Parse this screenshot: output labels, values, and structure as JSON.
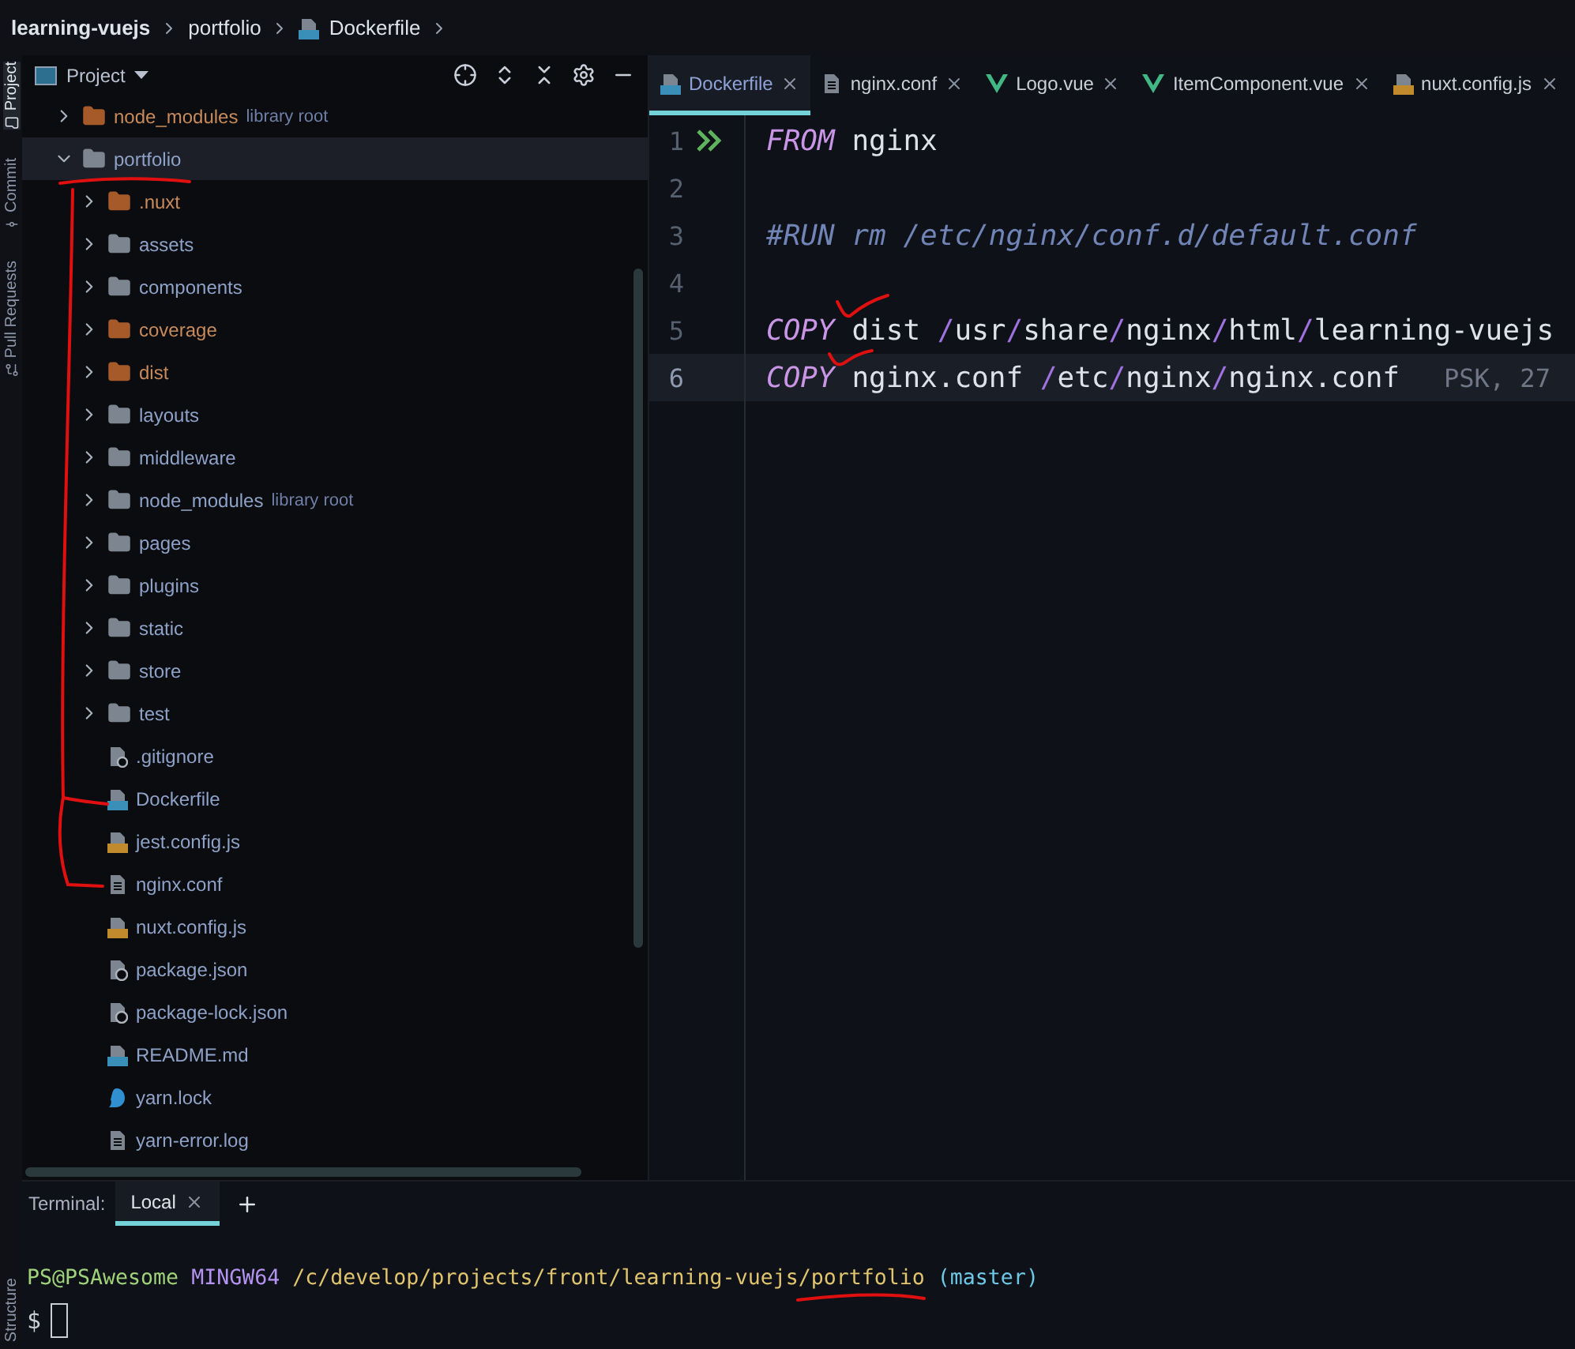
{
  "breadcrumbs": [
    {
      "label": "learning-vuejs",
      "kind": "project"
    },
    {
      "label": "portfolio",
      "kind": "folder"
    },
    {
      "label": "Dockerfile",
      "kind": "docker"
    }
  ],
  "tool_strip": [
    {
      "label": "Project",
      "selected": true,
      "kind": "folder"
    },
    {
      "label": "Commit",
      "selected": false,
      "kind": "commit"
    },
    {
      "label": "Pull Requests",
      "selected": false,
      "kind": "pull"
    }
  ],
  "bottom_tool_strip": [
    {
      "label": "Structure",
      "selected": false
    }
  ],
  "project_panel": {
    "title": "Project",
    "tree": [
      {
        "name": "node_modules",
        "kind": "folder",
        "ignored": true,
        "note": "library root",
        "expanded": false,
        "selected": false
      },
      {
        "name": "portfolio",
        "kind": "folder",
        "ignored": false,
        "expanded": true,
        "selected": true,
        "children": [
          {
            "name": ".nuxt",
            "kind": "folder",
            "ignored": true,
            "expanded": false,
            "selected": false
          },
          {
            "name": "assets",
            "kind": "folder",
            "ignored": false,
            "expanded": false,
            "selected": false
          },
          {
            "name": "components",
            "kind": "folder",
            "ignored": false,
            "expanded": false,
            "selected": false
          },
          {
            "name": "coverage",
            "kind": "folder",
            "ignored": true,
            "expanded": false,
            "selected": false
          },
          {
            "name": "dist",
            "kind": "folder",
            "ignored": true,
            "expanded": false,
            "selected": false
          },
          {
            "name": "layouts",
            "kind": "folder",
            "ignored": false,
            "expanded": false,
            "selected": false
          },
          {
            "name": "middleware",
            "kind": "folder",
            "ignored": false,
            "expanded": false,
            "selected": false
          },
          {
            "name": "node_modules",
            "kind": "folder",
            "ignored": false,
            "note": "library root",
            "expanded": false,
            "selected": false
          },
          {
            "name": "pages",
            "kind": "folder",
            "ignored": false,
            "expanded": false,
            "selected": false
          },
          {
            "name": "plugins",
            "kind": "folder",
            "ignored": false,
            "expanded": false,
            "selected": false
          },
          {
            "name": "static",
            "kind": "folder",
            "ignored": false,
            "expanded": false,
            "selected": false
          },
          {
            "name": "store",
            "kind": "folder",
            "ignored": false,
            "expanded": false,
            "selected": false
          },
          {
            "name": "test",
            "kind": "folder",
            "ignored": false,
            "expanded": false,
            "selected": false
          },
          {
            "name": ".gitignore",
            "kind": "gitignore",
            "selected": false
          },
          {
            "name": "Dockerfile",
            "kind": "docker",
            "selected": false
          },
          {
            "name": "jest.config.js",
            "kind": "js",
            "selected": false
          },
          {
            "name": "nginx.conf",
            "kind": "text",
            "selected": false
          },
          {
            "name": "nuxt.config.js",
            "kind": "js",
            "selected": false
          },
          {
            "name": "package.json",
            "kind": "json",
            "selected": false
          },
          {
            "name": "package-lock.json",
            "kind": "json",
            "selected": false
          },
          {
            "name": "README.md",
            "kind": "md",
            "selected": false
          },
          {
            "name": "yarn.lock",
            "kind": "yarn",
            "selected": false
          },
          {
            "name": "yarn-error.log",
            "kind": "text",
            "selected": false
          }
        ]
      }
    ]
  },
  "editor": {
    "tabs": [
      {
        "label": "Dockerfile",
        "kind": "docker",
        "selected": true
      },
      {
        "label": "nginx.conf",
        "kind": "text",
        "selected": false
      },
      {
        "label": "Logo.vue",
        "kind": "vue",
        "selected": false
      },
      {
        "label": "ItemComponent.vue",
        "kind": "vue",
        "selected": false
      },
      {
        "label": "nuxt.config.js",
        "kind": "js",
        "selected": false
      }
    ],
    "lines": [
      {
        "number": "1",
        "run": true,
        "selected": false,
        "tokens": [
          {
            "kind": "keyword",
            "text": "FROM"
          },
          {
            "kind": "plain",
            "text": " nginx"
          }
        ]
      },
      {
        "number": "2",
        "selected": false
      },
      {
        "number": "3",
        "selected": false,
        "tokens": [
          {
            "kind": "comment",
            "text": "#RUN rm /etc/nginx/conf.d/default.conf"
          }
        ]
      },
      {
        "number": "4",
        "selected": false
      },
      {
        "number": "5",
        "selected": false,
        "tokens": [
          {
            "kind": "keyword",
            "text": "COPY"
          },
          {
            "kind": "plain",
            "text": " dist "
          },
          {
            "kind": "sep",
            "text": "/"
          },
          {
            "kind": "plain",
            "text": "usr"
          },
          {
            "kind": "sep",
            "text": "/"
          },
          {
            "kind": "plain",
            "text": "share"
          },
          {
            "kind": "sep",
            "text": "/"
          },
          {
            "kind": "plain",
            "text": "nginx"
          },
          {
            "kind": "sep",
            "text": "/"
          },
          {
            "kind": "plain",
            "text": "html"
          },
          {
            "kind": "sep",
            "text": "/"
          },
          {
            "kind": "plain",
            "text": "learning-vuejs"
          }
        ]
      },
      {
        "number": "6",
        "selected": true,
        "hint": "PSK, 27",
        "tokens": [
          {
            "kind": "keyword",
            "text": "COPY"
          },
          {
            "kind": "plain",
            "text": " nginx.conf "
          },
          {
            "kind": "sep",
            "text": "/"
          },
          {
            "kind": "plain",
            "text": "etc"
          },
          {
            "kind": "sep",
            "text": "/"
          },
          {
            "kind": "plain",
            "text": "nginx"
          },
          {
            "kind": "sep",
            "text": "/"
          },
          {
            "kind": "plain",
            "text": "nginx.conf"
          }
        ]
      }
    ]
  },
  "terminal": {
    "title": "Terminal:",
    "tabs": [
      {
        "label": "Local",
        "selected": true
      }
    ],
    "prompt": [
      {
        "kind": "user",
        "text": "PS@PSAwesome"
      },
      {
        "kind": "system",
        "text": "MINGW64"
      },
      {
        "kind": "path",
        "text": "/c/develop/projects/front/learning-vuejs/portfolio"
      },
      {
        "kind": "branch",
        "text": "(master)"
      }
    ],
    "input_prompt": "$"
  }
}
